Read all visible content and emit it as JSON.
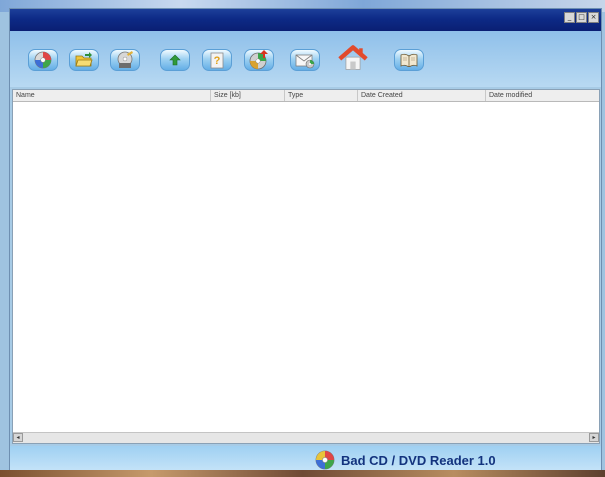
{
  "app": {
    "status_title": "Bad CD / DVD Reader 1.0"
  },
  "window_controls": {
    "minimize": "_",
    "maximize": "□",
    "close": "×"
  },
  "toolbar": {
    "buttons": [
      {
        "icon": "cd-disc-icon"
      },
      {
        "icon": "open-folder-icon"
      },
      {
        "icon": "disc-edit-icon"
      },
      {
        "icon": "up-arrow-icon"
      },
      {
        "icon": "help-icon"
      },
      {
        "icon": "disc-download-icon"
      },
      {
        "icon": "disc-mail-icon"
      },
      {
        "icon": "home-icon"
      },
      {
        "icon": "book-icon"
      }
    ]
  },
  "file_list": {
    "columns": [
      "Name",
      "Size [kb]",
      "Type",
      "Date Created",
      "Date modified"
    ]
  },
  "scrollbar": {
    "left_arrow": "◂",
    "right_arrow": "▸"
  },
  "colors": {
    "title_bar": "#0d2a86",
    "toolbar_bg": "#a7cbe6",
    "status_text": "#13337e"
  }
}
